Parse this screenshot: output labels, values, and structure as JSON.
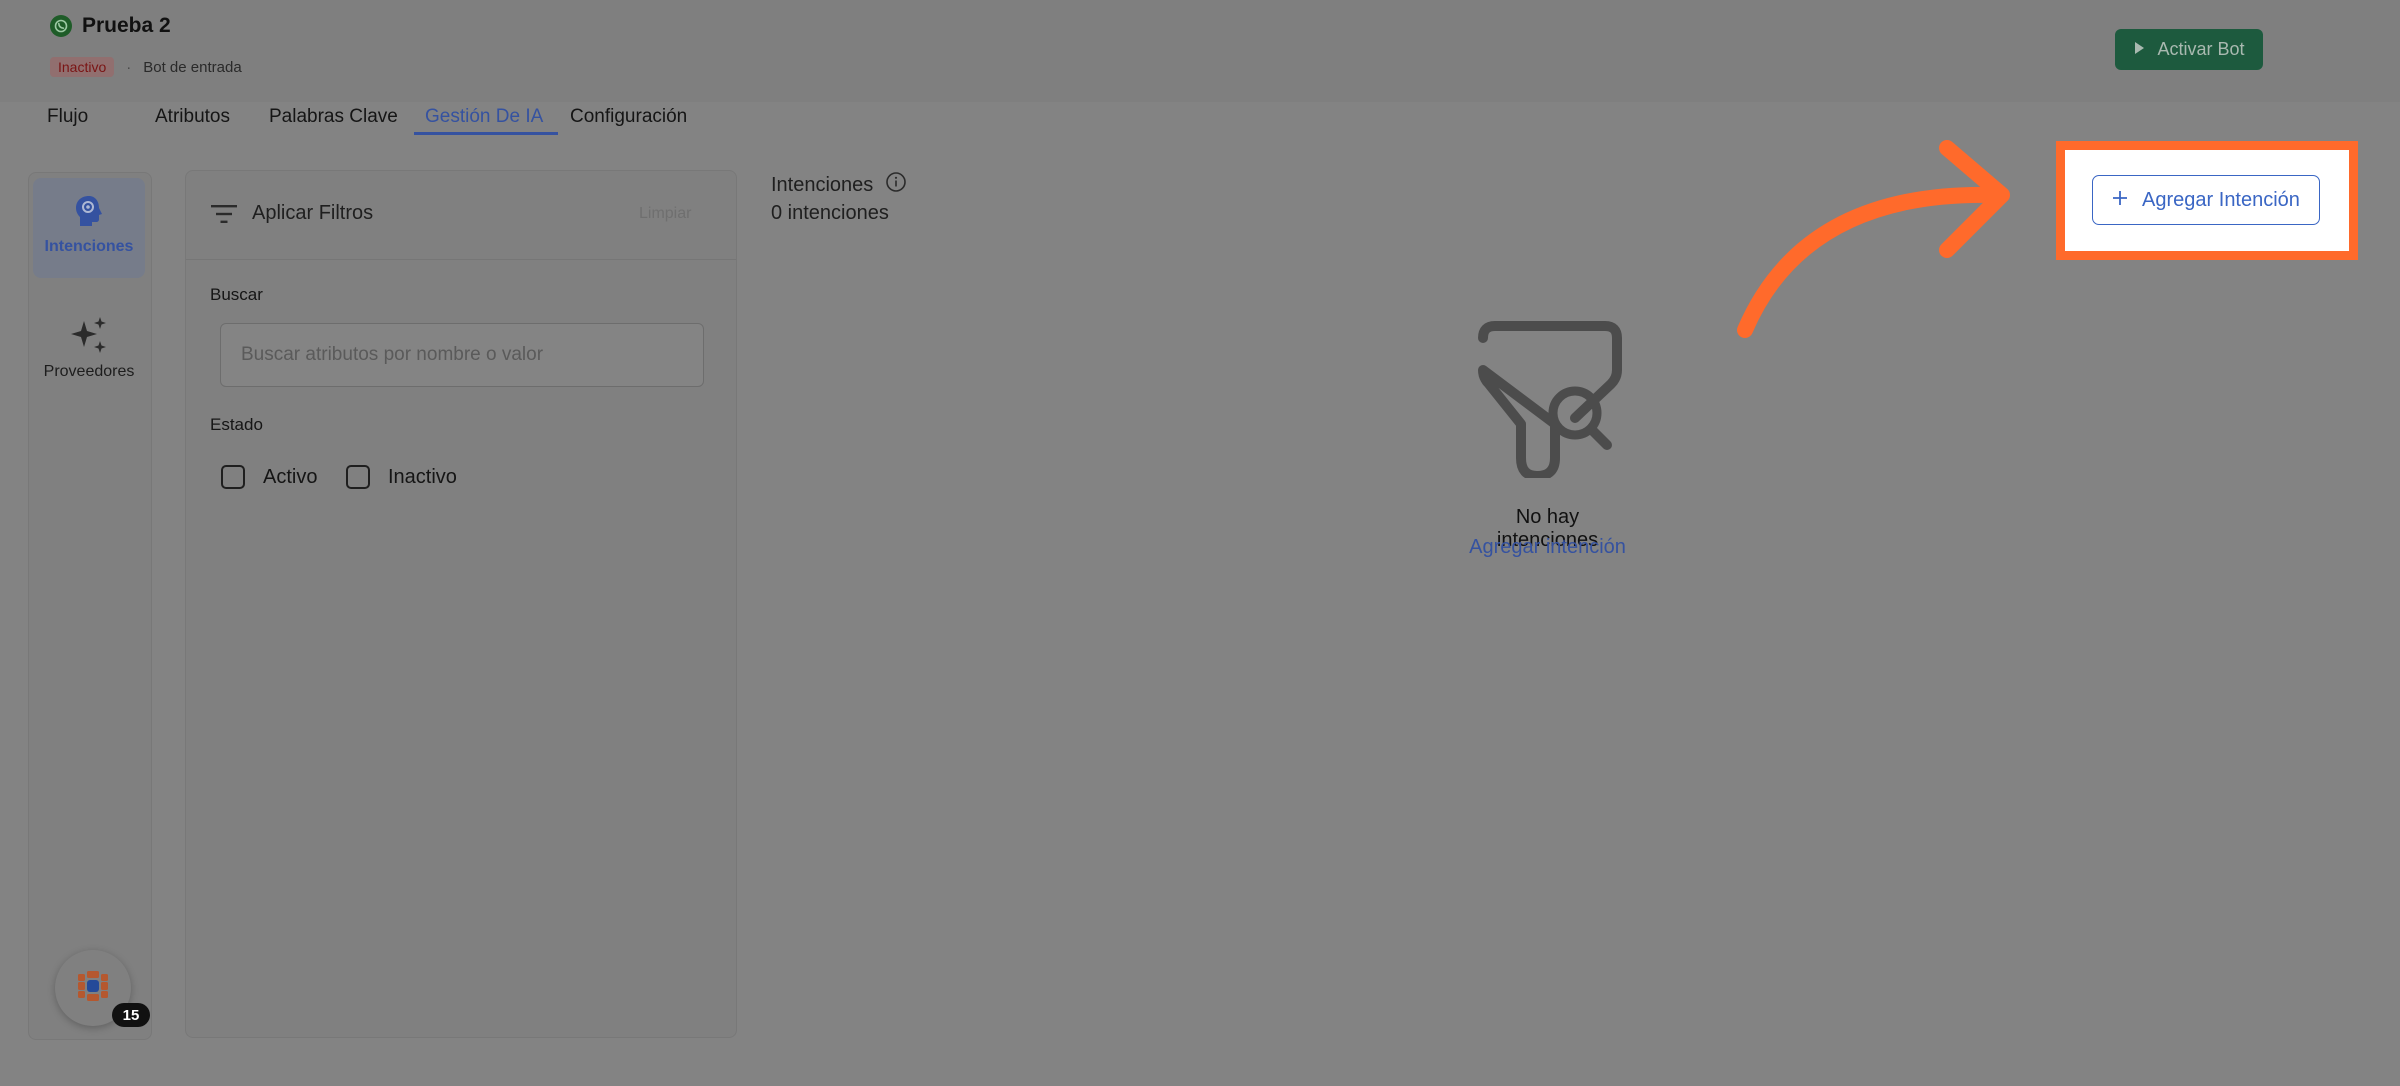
{
  "header": {
    "title": "Prueba 2",
    "status_badge": "Inactivo",
    "separator": "·",
    "subtitle": "Bot de entrada",
    "activate_button": "Activar Bot"
  },
  "tabs": [
    {
      "label": "Flujo"
    },
    {
      "label": "Atributos"
    },
    {
      "label": "Palabras Clave"
    },
    {
      "label": "Gestión De IA",
      "active": true
    },
    {
      "label": "Configuración"
    }
  ],
  "sidebar": {
    "items": [
      {
        "label": "Intenciones",
        "icon": "brain-gear-icon",
        "active": true
      },
      {
        "label": "Proveedores",
        "icon": "sparkles-icon"
      }
    ],
    "help_badge_count": "15"
  },
  "filters": {
    "title": "Aplicar Filtros",
    "clear_label": "Limpiar",
    "search_label": "Buscar",
    "search_placeholder": "Buscar atributos por nombre o valor",
    "status_label": "Estado",
    "status_options": [
      {
        "label": "Activo",
        "checked": false
      },
      {
        "label": "Inactivo",
        "checked": false
      }
    ]
  },
  "content": {
    "title": "Intenciones",
    "count_text": "0 intenciones",
    "empty_title": "No hay intenciones",
    "empty_link": "Agregar intención",
    "add_button": "Agregar Intención"
  },
  "colors": {
    "accent": "#3552a0",
    "highlight": "#ff6a2b",
    "activate_button": "#1d5a3e"
  }
}
